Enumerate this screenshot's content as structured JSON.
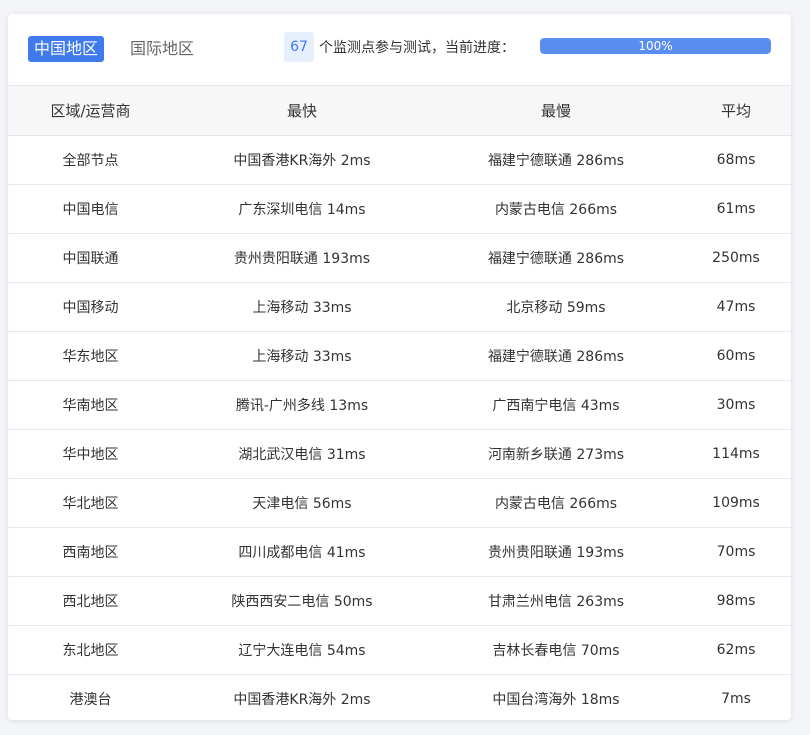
{
  "tabs": {
    "china": "中国地区",
    "international": "国际地区"
  },
  "monitor": {
    "count": "67",
    "text": "个监测点参与测试，当前进度：",
    "progress_label": "100%",
    "progress_fraction": 1.0
  },
  "colors": {
    "accent": "#3f7bef",
    "progress_bar": "#5a8df0"
  },
  "table": {
    "headers": [
      "区域/运营商",
      "最快",
      "最慢",
      "平均"
    ],
    "rows": [
      [
        "全部节点",
        "中国香港KR海外 2ms",
        "福建宁德联通 286ms",
        "68ms"
      ],
      [
        "中国电信",
        "广东深圳电信 14ms",
        "内蒙古电信 266ms",
        "61ms"
      ],
      [
        "中国联通",
        "贵州贵阳联通 193ms",
        "福建宁德联通 286ms",
        "250ms"
      ],
      [
        "中国移动",
        "上海移动 33ms",
        "北京移动 59ms",
        "47ms"
      ],
      [
        "华东地区",
        "上海移动 33ms",
        "福建宁德联通 286ms",
        "60ms"
      ],
      [
        "华南地区",
        "腾讯-广州多线 13ms",
        "广西南宁电信 43ms",
        "30ms"
      ],
      [
        "华中地区",
        "湖北武汉电信 31ms",
        "河南新乡联通 273ms",
        "114ms"
      ],
      [
        "华北地区",
        "天津电信 56ms",
        "内蒙古电信 266ms",
        "109ms"
      ],
      [
        "西南地区",
        "四川成都电信 41ms",
        "贵州贵阳联通 193ms",
        "70ms"
      ],
      [
        "西北地区",
        "陕西西安二电信 50ms",
        "甘肃兰州电信 263ms",
        "98ms"
      ],
      [
        "东北地区",
        "辽宁大连电信 54ms",
        "吉林长春电信 70ms",
        "62ms"
      ],
      [
        "港澳台",
        "中国香港KR海外 2ms",
        "中国台湾海外 18ms",
        "7ms"
      ]
    ]
  }
}
